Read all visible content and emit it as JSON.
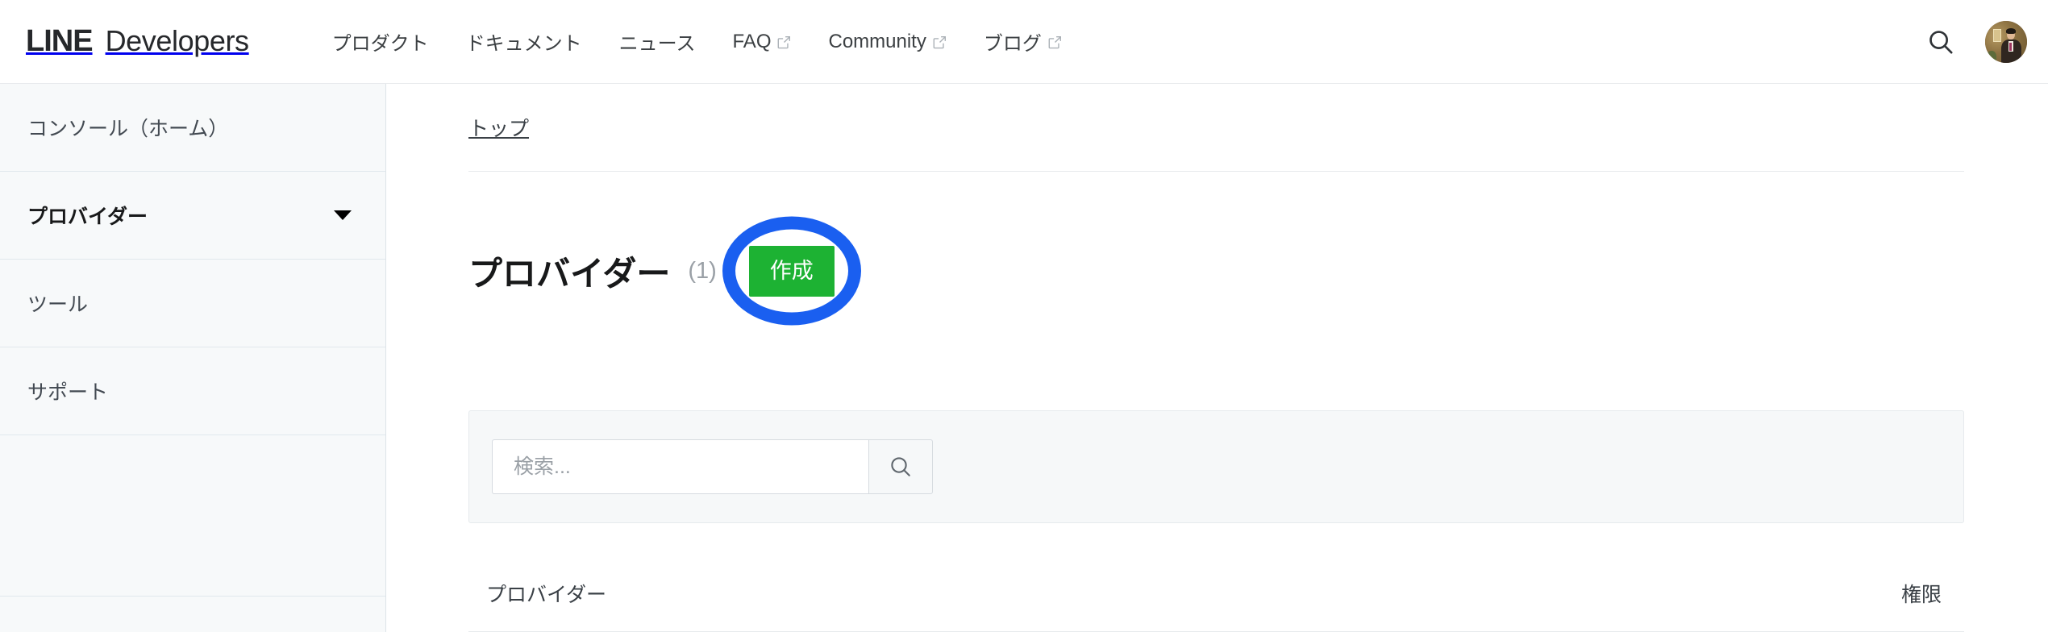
{
  "header": {
    "brand_line": "LINE",
    "brand_dev": "Developers",
    "nav": [
      {
        "label": "プロダクト",
        "external": false
      },
      {
        "label": "ドキュメント",
        "external": false
      },
      {
        "label": "ニュース",
        "external": false
      },
      {
        "label": "FAQ",
        "external": true
      },
      {
        "label": "Community",
        "external": true
      },
      {
        "label": "ブログ",
        "external": true
      }
    ],
    "search_icon": "search-icon",
    "avatar_icon": "user-avatar"
  },
  "sidebar": {
    "items": [
      {
        "label": "コンソール（ホーム）",
        "active": false,
        "caret": false
      },
      {
        "label": "プロバイダー",
        "active": true,
        "caret": true
      },
      {
        "label": "ツール",
        "active": false,
        "caret": false
      },
      {
        "label": "サポート",
        "active": false,
        "caret": false
      }
    ]
  },
  "main": {
    "breadcrumb": "トップ",
    "title": "プロバイダー",
    "count": "(1)",
    "create_label": "作成",
    "search": {
      "placeholder": "検索...",
      "value": "",
      "button_icon": "search-icon"
    },
    "table": {
      "columns": [
        {
          "key": "provider",
          "label": "プロバイダー"
        },
        {
          "key": "permission",
          "label": "権限"
        }
      ],
      "rows": []
    }
  },
  "annotation": {
    "type": "ellipse-highlight",
    "target": "create-button",
    "color": "#1a5ff0"
  },
  "colors": {
    "brand_green": "#1db233",
    "annotation_blue": "#1a5ff0",
    "sidebar_bg": "#f7f9fa",
    "panel_bg": "#f6f8f9",
    "text_primary": "#18191a",
    "text_secondary": "#3a4046",
    "text_muted": "#9aa0a6"
  }
}
